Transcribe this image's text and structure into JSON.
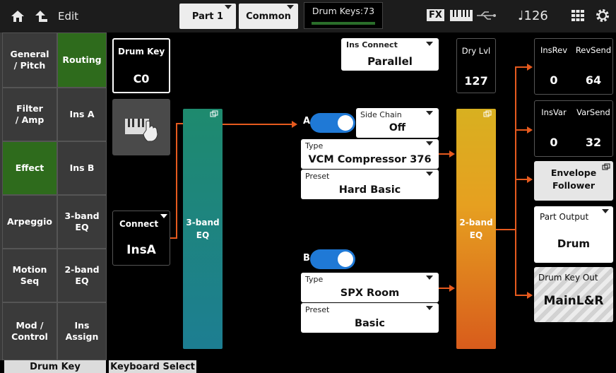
{
  "header": {
    "edit_label": "Edit",
    "part_label": "Part 1",
    "common_label": "Common",
    "drum_keys_label": "Drum Keys:73",
    "fx_label": "FX",
    "tempo": "♩126"
  },
  "sidebar": {
    "left": [
      "General\n/ Pitch",
      "Filter\n/ Amp",
      "Effect",
      "Arpeggio",
      "Motion Seq",
      "Mod /\nControl"
    ],
    "right": [
      "Routing",
      "Ins A",
      "Ins B",
      "3-band\nEQ",
      "2-band\nEQ",
      "Ins\nAssign"
    ]
  },
  "drum_key": {
    "label": "Drum Key",
    "value": "C0"
  },
  "connect": {
    "label": "Connect",
    "value": "InsA"
  },
  "eq3": {
    "label": "3-band\nEQ"
  },
  "eq2": {
    "label": "2-band\nEQ"
  },
  "ins_connect": {
    "label": "Ins Connect",
    "value": "Parallel"
  },
  "dry_level": {
    "label": "Dry Lvl",
    "value": "127"
  },
  "ins_a": {
    "letter": "A",
    "side_chain_label": "Side Chain",
    "side_chain_value": "Off",
    "type_label": "Type",
    "type_value": "VCM Compressor 376",
    "preset_label": "Preset",
    "preset_value": "Hard Basic"
  },
  "ins_b": {
    "letter": "B",
    "type_label": "Type",
    "type_value": "SPX Room",
    "preset_label": "Preset",
    "preset_value": "Basic"
  },
  "sends": {
    "ins_rev_label": "InsRev",
    "ins_rev_value": "0",
    "rev_send_label": "RevSend",
    "rev_send_value": "64",
    "ins_var_label": "InsVar",
    "ins_var_value": "0",
    "var_send_label": "VarSend",
    "var_send_value": "32"
  },
  "envelope_follower": {
    "label": "Envelope\nFollower"
  },
  "part_output": {
    "label": "Part Output",
    "value": "Drum"
  },
  "drum_key_out": {
    "label": "Drum Key Out",
    "value": "MainL&R"
  },
  "bottom_tabs": [
    "Drum Key",
    "Keyboard Select"
  ],
  "colors": {
    "accent_green": "#2e6b1c",
    "route_orange": "#e65a1e",
    "toggle_blue": "#1f79d6"
  }
}
